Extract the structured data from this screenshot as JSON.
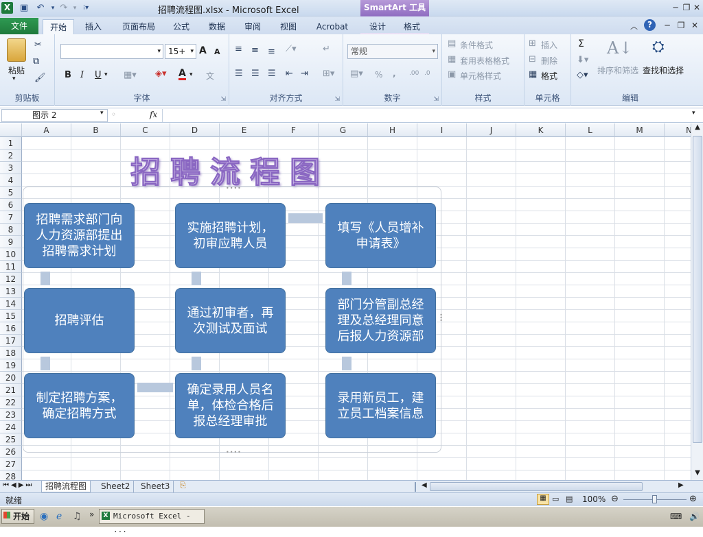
{
  "window": {
    "title": "招聘流程图.xlsx - Microsoft Excel",
    "contextual_tab": "SmartArt 工具"
  },
  "tabs": {
    "file": "文件",
    "home": "开始",
    "insert": "插入",
    "page_layout": "页面布局",
    "formulas": "公式",
    "data": "数据",
    "review": "审阅",
    "view": "视图",
    "acrobat": "Acrobat",
    "design": "设计",
    "format": "格式"
  },
  "ribbon": {
    "clipboard": {
      "paste": "粘贴",
      "label": "剪贴板"
    },
    "font": {
      "size": "15+",
      "bold": "B",
      "italic": "I",
      "underline": "U",
      "label": "字体",
      "grow": "A",
      "shrink": "A",
      "font_color": "A",
      "phonetic": "文"
    },
    "alignment": {
      "label": "对齐方式"
    },
    "number": {
      "format": "常规",
      "percent": "%",
      "comma": ",",
      "inc_decimal": ".00",
      "label": "数字"
    },
    "styles": {
      "conditional": "条件格式",
      "table": "套用表格格式",
      "cell_styles": "单元格样式",
      "label": "样式"
    },
    "cells": {
      "insert": "插入",
      "delete": "删除",
      "format": "格式",
      "label": "单元格"
    },
    "editing": {
      "sort": "排序和筛选",
      "find": "查找和选择",
      "label": "编辑",
      "sum": "Σ"
    }
  },
  "formula_bar": {
    "name_box": "图示 2",
    "fx": "fx",
    "value": ""
  },
  "columns": [
    "A",
    "B",
    "C",
    "D",
    "E",
    "F",
    "G",
    "H",
    "I",
    "J",
    "K",
    "L",
    "M",
    "N"
  ],
  "rows": [
    "1",
    "2",
    "3",
    "4",
    "5",
    "6",
    "7",
    "8",
    "9",
    "10",
    "11",
    "12",
    "13",
    "14",
    "15",
    "16",
    "17",
    "18",
    "19",
    "20",
    "21",
    "22",
    "23",
    "24",
    "25",
    "26",
    "27",
    "28"
  ],
  "wordart": "招聘流程图",
  "smartart": {
    "boxes": [
      "招聘需求部门向\n人力资源部提出\n招聘需求计划",
      "实施招聘计划，\n初审应聘人员",
      "填写《人员增补\n申请表》",
      "招聘评估",
      "通过初审者，再\n次测试及面试",
      "部门分管副总经\n理及总经理同意\n后报人力资源部",
      "制定招聘方案，\n确定招聘方式",
      "确定录用人员名\n单，体检合格后\n报总经理审批",
      "录用新员工，建\n立员工档案信息"
    ],
    "box_color": "#4f81bd",
    "connector_color": "#b8c8dd"
  },
  "sheets": [
    "招聘流程图",
    "Sheet2",
    "Sheet3"
  ],
  "status": {
    "ready": "就绪",
    "zoom": "100%"
  },
  "taskbar": {
    "start": "开始",
    "excel_task": "Microsoft Excel - ...",
    "more": "»"
  }
}
